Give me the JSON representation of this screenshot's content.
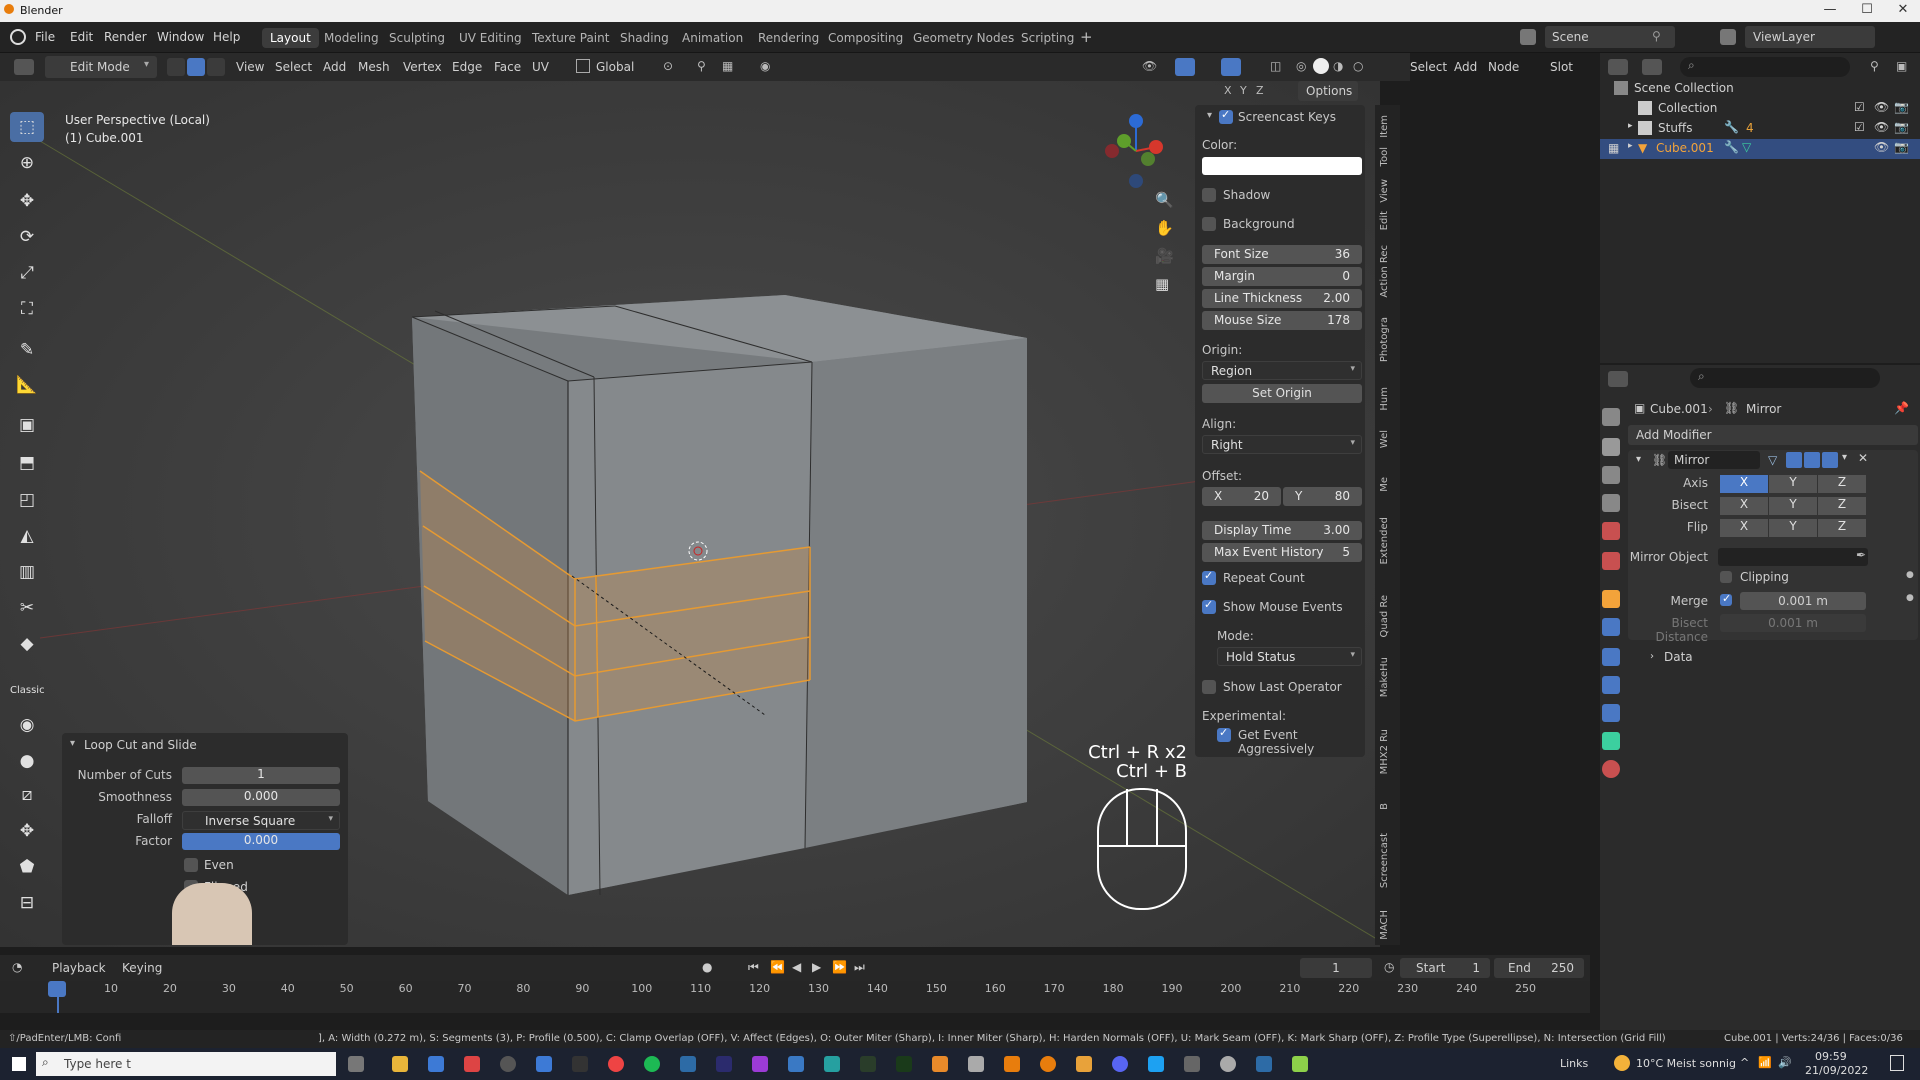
{
  "window": {
    "title": "Blender"
  },
  "menu": [
    "File",
    "Edit",
    "Render",
    "Window",
    "Help"
  ],
  "workspaces": [
    "Layout",
    "Modeling",
    "Sculpting",
    "UV Editing",
    "Texture Paint",
    "Shading",
    "Animation",
    "Rendering",
    "Compositing",
    "Geometry Nodes",
    "Scripting"
  ],
  "scene": {
    "label": "Scene",
    "view_layer": "ViewLayer"
  },
  "header": {
    "mode": "Edit Mode",
    "menus": [
      "View",
      "Select",
      "Add",
      "Mesh",
      "Vertex",
      "Edge",
      "Face",
      "UV"
    ],
    "transform": "Global",
    "right_menus": [
      "Select",
      "Add",
      "Node"
    ],
    "slot": "Slot",
    "options": "Options"
  },
  "viewport": {
    "perspective": "User Perspective (Local)",
    "object": "(1) Cube.001",
    "key_overlay_1": "Ctrl + R x2",
    "key_overlay_2": "Ctrl + B"
  },
  "npanel": {
    "section": "Screencast Keys",
    "color_label": "Color:",
    "shadow": "Shadow",
    "background": "Background",
    "font_size_label": "Font Size",
    "font_size": "36",
    "margin_label": "Margin",
    "margin": "0",
    "line_thickness_label": "Line Thickness",
    "line_thickness": "2.00",
    "mouse_size_label": "Mouse Size",
    "mouse_size": "178",
    "origin_label": "Origin:",
    "origin": "Region",
    "set_origin": "Set Origin",
    "align_label": "Align:",
    "align": "Right",
    "offset_label": "Offset:",
    "offset_x_label": "X",
    "offset_x": "20",
    "offset_y_label": "Y",
    "offset_y": "80",
    "display_time_label": "Display Time",
    "display_time": "3.00",
    "max_event_label": "Max Event History",
    "max_event": "5",
    "repeat_count": "Repeat Count",
    "show_mouse": "Show Mouse Events",
    "mode_label": "Mode:",
    "mode": "Hold Status",
    "show_last": "Show Last Operator",
    "experimental_label": "Experimental:",
    "get_event": "Get Event Aggressively"
  },
  "sidetabs": [
    "Item",
    "Tool",
    "View",
    "Edit",
    "Action Rec",
    "Photogra",
    "Hum",
    "Wel",
    "Me",
    "Extended",
    "Quad Re",
    "MakeHu",
    "MHX2 Ru",
    "B",
    "Screencast",
    "MACH"
  ],
  "loopcut": {
    "title": "Loop Cut and Slide",
    "cuts_label": "Number of Cuts",
    "cuts": "1",
    "smooth_label": "Smoothness",
    "smooth": "0.000",
    "falloff_label": "Falloff",
    "falloff": "Inverse Square",
    "factor_label": "Factor",
    "factor": "0.000",
    "even": "Even",
    "flipped": "Flipped"
  },
  "outliner": {
    "root": "Scene Collection",
    "items": [
      "Collection",
      "Stuffs",
      "Cube.001"
    ],
    "badge": "4"
  },
  "props": {
    "object": "Cube.001",
    "modifier_crumb": "Mirror",
    "add_modifier": "Add Modifier",
    "modifier_name": "Mirror",
    "axis_label": "Axis",
    "bisect_label": "Bisect",
    "flip_label": "Flip",
    "x": "X",
    "y": "Y",
    "z": "Z",
    "mirror_object_label": "Mirror Object",
    "clipping": "Clipping",
    "merge_label": "Merge",
    "merge": "0.001 m",
    "bisect_distance_label": "Bisect Distance",
    "bisect_distance": "0.001 m",
    "data": "Data"
  },
  "timeline": {
    "playback": "Playback",
    "keying": "Keying",
    "current_frame": "1",
    "start_label": "Start",
    "start": "1",
    "end_label": "End",
    "end": "250",
    "ticks": [
      "1",
      "10",
      "20",
      "30",
      "40",
      "50",
      "60",
      "70",
      "80",
      "90",
      "100",
      "110",
      "120",
      "130",
      "140",
      "150",
      "160",
      "170",
      "180",
      "190",
      "200",
      "210",
      "220",
      "230",
      "240",
      "250"
    ]
  },
  "status": {
    "left": "⇧/PadEnter/LMB: Confi",
    "middle": "], A: Width (0.272 m), S: Segments (3), P: Profile (0.500), C: Clamp Overlap (OFF), V: Affect (Edges), O: Outer Miter (Sharp), I: Inner Miter (Sharp), H: Harden Normals (OFF), U: Mark Seam (OFF), K: Mark Sharp (OFF), Z: Profile Type (Superellipse), N: Intersection (Grid Fill)",
    "right": "Cube.001 | Verts:24/36 | Faces:0/36"
  },
  "taskbar": {
    "search": "Type here t",
    "links": "Links",
    "weather": "10°C  Meist sonnig",
    "time": "09:59",
    "date": "21/09/2022"
  }
}
